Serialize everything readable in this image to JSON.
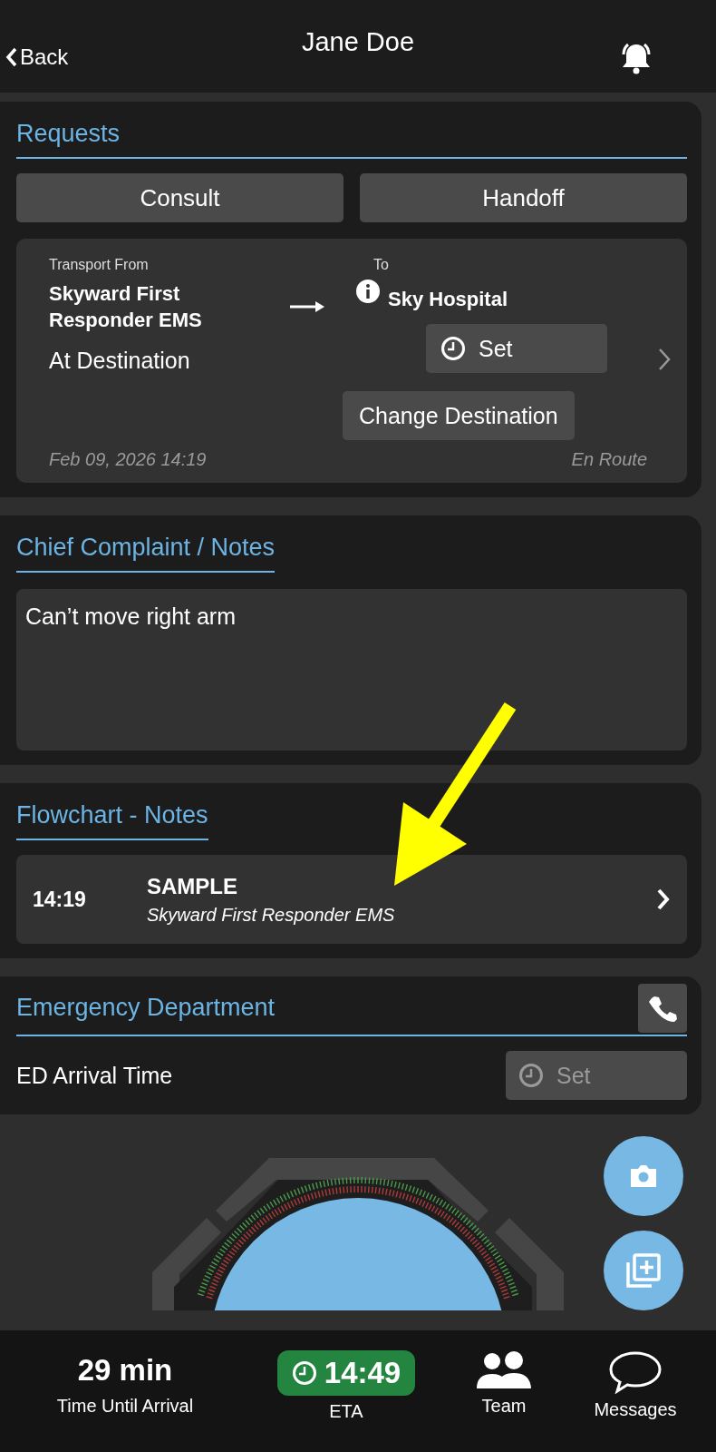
{
  "header": {
    "back": "Back",
    "title": "Jane Doe"
  },
  "requests": {
    "title": "Requests",
    "buttons": [
      "Consult",
      "Handoff"
    ],
    "transport": {
      "from_label": "Transport From",
      "from": "Skyward First Responder EMS",
      "status": "At Destination",
      "to_label": "To",
      "to": "Sky Hospital",
      "set_button": "Set",
      "change_button": "Change Destination",
      "timestamp": "Feb 09, 2026 14:19",
      "state": "En Route"
    }
  },
  "chief_complaint": {
    "title": "Chief Complaint / Notes",
    "value": "Can’t move right arm"
  },
  "flowchart": {
    "title": "Flowchart - Notes",
    "items": [
      {
        "time": "14:19",
        "title": "SAMPLE",
        "source": "Skyward First Responder EMS"
      }
    ]
  },
  "emergency_department": {
    "title": "Emergency Department",
    "rows": [
      {
        "label": "ED Arrival Time",
        "button": "Set",
        "disabled": true
      }
    ]
  },
  "bottom_bar": {
    "items": [
      {
        "kind": "stat",
        "value": "29 min",
        "label": "Time Until Arrival"
      },
      {
        "kind": "eta",
        "value": "14:49",
        "label": "ETA"
      },
      {
        "kind": "team",
        "label": "Team"
      },
      {
        "kind": "messages",
        "label": "Messages"
      }
    ]
  }
}
